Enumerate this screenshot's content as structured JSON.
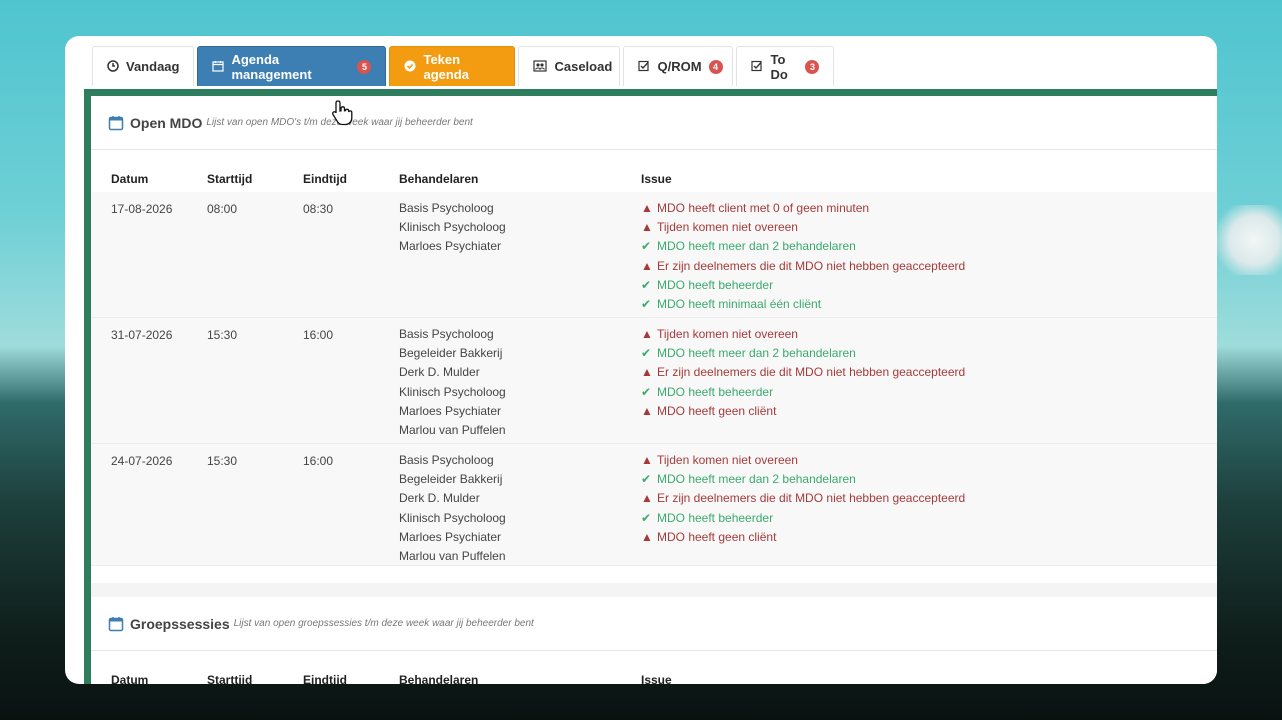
{
  "tabs": [
    {
      "label": "Vandaag",
      "icon": "clock-icon",
      "state": "default"
    },
    {
      "label": "Agenda management",
      "icon": "calendar-icon",
      "badge": "5",
      "state": "active"
    },
    {
      "label": "Teken agenda",
      "icon": "check-circle-icon",
      "state": "orange"
    },
    {
      "label": "Caseload",
      "icon": "users-icon",
      "state": "default"
    },
    {
      "label": "Q/ROM",
      "icon": "checkbox-icon",
      "badge": "4",
      "state": "default"
    },
    {
      "label": "To Do",
      "icon": "checkbox-icon",
      "badge": "3",
      "state": "default"
    }
  ],
  "open_mdo": {
    "title": "Open MDO",
    "subtitle": "Lijst van open MDO's t/m deze week waar jij beheerder bent",
    "columns": [
      "Datum",
      "Starttijd",
      "Eindtijd",
      "Behandelaren",
      "Issue"
    ],
    "rows": [
      {
        "datum": "17-08-2026",
        "start": "08:00",
        "eind": "08:30",
        "behandelaren": [
          "Basis Psycholoog",
          "Klinisch Psycholoog",
          "Marloes Psychiater"
        ],
        "issues": [
          {
            "text": "MDO heeft client met 0 of geen minuten",
            "status": "bad"
          },
          {
            "text": "Tijden komen niet overeen",
            "status": "bad"
          },
          {
            "text": "MDO heeft meer dan 2 behandelaren",
            "status": "ok"
          },
          {
            "text": "Er zijn deelnemers die dit MDO niet hebben geaccepteerd",
            "status": "bad"
          },
          {
            "text": "MDO heeft beheerder",
            "status": "ok"
          },
          {
            "text": "MDO heeft minimaal één cliënt",
            "status": "ok"
          }
        ]
      },
      {
        "datum": "31-07-2026",
        "start": "15:30",
        "eind": "16:00",
        "behandelaren": [
          "Basis Psycholoog",
          "Begeleider Bakkerij",
          "Derk D. Mulder",
          "Klinisch Psycholoog",
          "Marloes Psychiater",
          "Marlou van Puffelen"
        ],
        "issues": [
          {
            "text": "Tijden komen niet overeen",
            "status": "bad"
          },
          {
            "text": "MDO heeft meer dan 2 behandelaren",
            "status": "ok"
          },
          {
            "text": "Er zijn deelnemers die dit MDO niet hebben geaccepteerd",
            "status": "bad"
          },
          {
            "text": "MDO heeft beheerder",
            "status": "ok"
          },
          {
            "text": "MDO heeft geen cliënt",
            "status": "bad"
          }
        ]
      },
      {
        "datum": "24-07-2026",
        "start": "15:30",
        "eind": "16:00",
        "behandelaren": [
          "Basis Psycholoog",
          "Begeleider Bakkerij",
          "Derk D. Mulder",
          "Klinisch Psycholoog",
          "Marloes Psychiater",
          "Marlou van Puffelen"
        ],
        "issues": [
          {
            "text": "Tijden komen niet overeen",
            "status": "bad"
          },
          {
            "text": "MDO heeft meer dan 2 behandelaren",
            "status": "ok"
          },
          {
            "text": "Er zijn deelnemers die dit MDO niet hebben geaccepteerd",
            "status": "bad"
          },
          {
            "text": "MDO heeft beheerder",
            "status": "ok"
          },
          {
            "text": "MDO heeft geen cliënt",
            "status": "bad"
          }
        ]
      }
    ]
  },
  "groepssessies": {
    "title": "Groepssessies",
    "subtitle": "Lijst van open groepssessies t/m deze week waar jij beheerder bent",
    "columns": [
      "Datum",
      "Starttijd",
      "Eindtijd",
      "Behandelaren",
      "Issue"
    ]
  },
  "colors": {
    "active_tab": "#3d7fb3",
    "orange_tab": "#f39c12",
    "panel_border": "#2e7d5e",
    "bad": "#a63a3a",
    "ok": "#3aaa6d",
    "badge": "#d9534f"
  }
}
